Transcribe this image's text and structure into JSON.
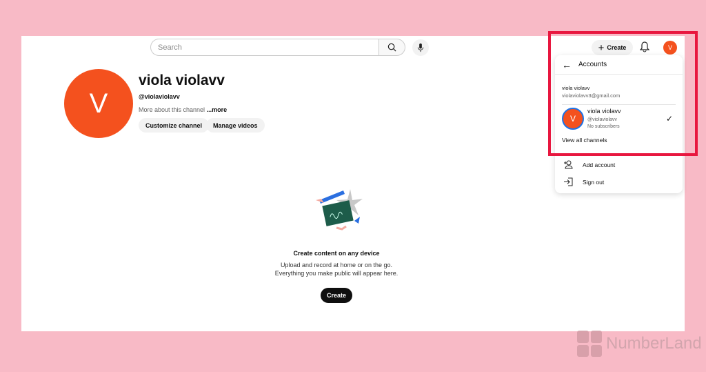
{
  "search": {
    "placeholder": "Search"
  },
  "channel": {
    "avatar_letter": "V",
    "name": "viola violavv",
    "handle": "@violaviolavv",
    "about": "More about this channel",
    "more": "...more",
    "buttons": [
      "Customize channel",
      "Manage videos"
    ]
  },
  "empty": {
    "title": "Create content on any device",
    "line1": "Upload and record at home or on the go.",
    "line2": "Everything you make public will appear here.",
    "button": "Create"
  },
  "header": {
    "create_label": "Create",
    "avatar_letter": "V"
  },
  "accounts_menu": {
    "title": "Accounts",
    "account_name": "viola violavv",
    "account_email": "violaviolavv3@gmail.com",
    "channel": {
      "avatar_letter": "V",
      "name": "viola violavv",
      "handle": "@violaviolavv",
      "subscribers": "No subscribers",
      "selected": true
    },
    "view_all": "View all channels",
    "items": [
      {
        "label": "Add account",
        "icon": "add-person-icon"
      },
      {
        "label": "Sign out",
        "icon": "sign-out-icon"
      }
    ]
  },
  "watermark": {
    "brand": "NumberLand"
  },
  "colors": {
    "highlight": "#e8173f",
    "avatar": "#f4511e",
    "background": "#f8bac6"
  }
}
